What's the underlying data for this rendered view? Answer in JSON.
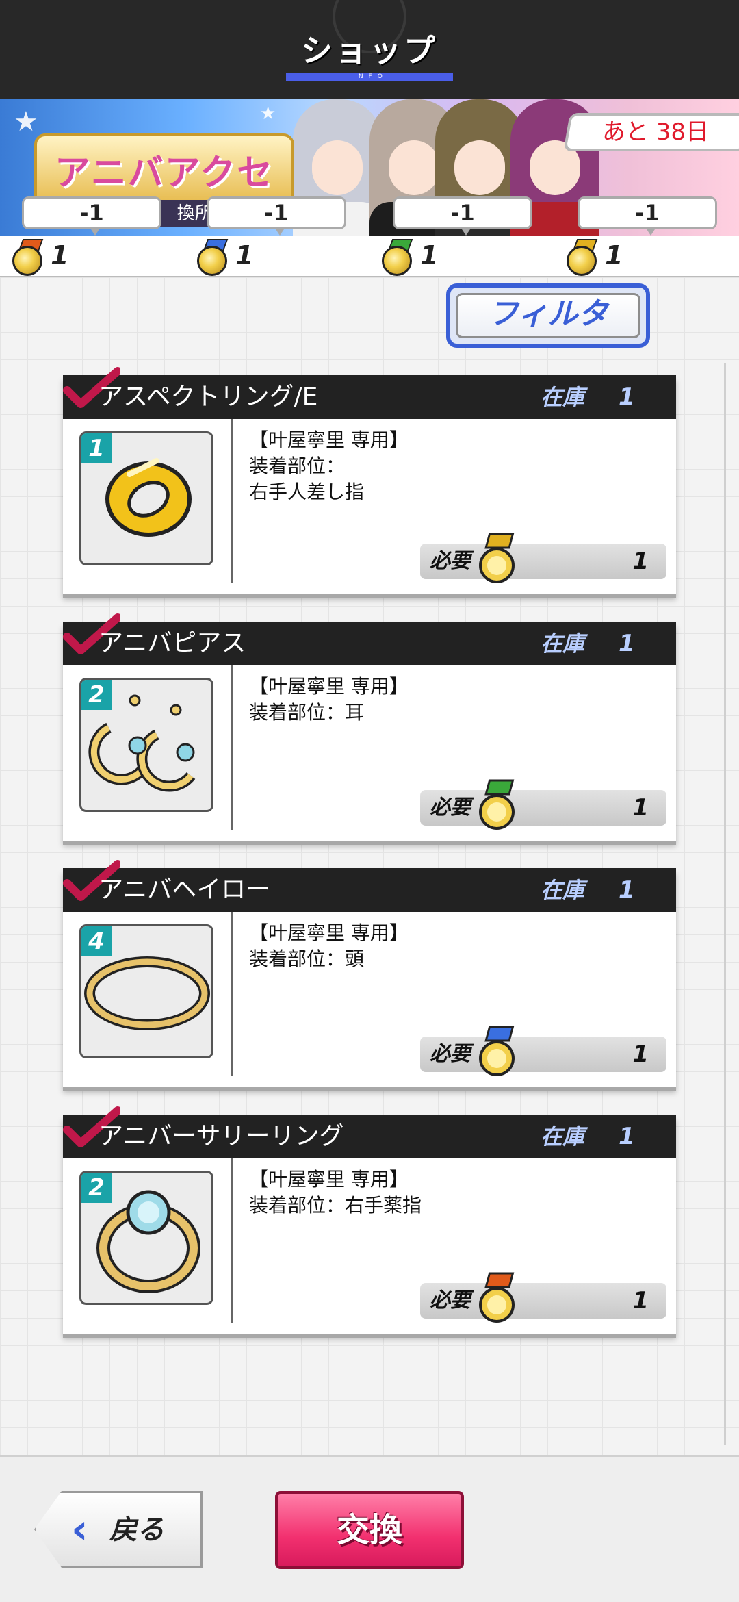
{
  "header": {
    "title": "ショップ",
    "subtitle": "INFO"
  },
  "banner": {
    "logo_text": "アニバアクセ",
    "logo_sub": "換所Pa",
    "days_left": "あと 38日"
  },
  "currencies": [
    {
      "bubble": "-1",
      "count": "1",
      "ribbon_color": "#e05a1a"
    },
    {
      "bubble": "-1",
      "count": "1",
      "ribbon_color": "#3a6fe0"
    },
    {
      "bubble": "-1",
      "count": "1",
      "ribbon_color": "#3aa83a"
    },
    {
      "bubble": "-1",
      "count": "1",
      "ribbon_color": "#e0b020"
    }
  ],
  "filter": {
    "label": "フィルタ"
  },
  "items": [
    {
      "name": "アスペクトリング/E",
      "stock_label": "在庫",
      "stock": "1",
      "rarity": "1",
      "owner": "【叶屋寧里 専用】",
      "slot_line1": "装着部位：",
      "slot_line2": "右手人差し指",
      "need_label": "必要",
      "need_count": "1",
      "need_ribbon": "#e0b020",
      "icon": "ring-icon"
    },
    {
      "name": "アニバピアス",
      "stock_label": "在庫",
      "stock": "1",
      "rarity": "2",
      "owner": "【叶屋寧里 専用】",
      "slot_line1": "装着部位：耳",
      "slot_line2": "",
      "need_label": "必要",
      "need_count": "1",
      "need_ribbon": "#3aa83a",
      "icon": "earrings-icon"
    },
    {
      "name": "アニバヘイロー",
      "stock_label": "在庫",
      "stock": "1",
      "rarity": "4",
      "owner": "【叶屋寧里 専用】",
      "slot_line1": "装着部位：頭",
      "slot_line2": "",
      "need_label": "必要",
      "need_count": "1",
      "need_ribbon": "#3a6fe0",
      "icon": "halo-icon"
    },
    {
      "name": "アニバーサリーリング",
      "stock_label": "在庫",
      "stock": "1",
      "rarity": "2",
      "owner": "【叶屋寧里 専用】",
      "slot_line1": "装着部位：右手薬指",
      "slot_line2": "",
      "need_label": "必要",
      "need_count": "1",
      "need_ribbon": "#e05a1a",
      "icon": "gem-ring-icon"
    }
  ],
  "footer": {
    "back_label": "戻る",
    "exchange_label": "交換"
  },
  "colors": {
    "accent": "#3a5fd6",
    "exchange": "#f2306f",
    "days_text": "#e01a2c",
    "rarity_badge": "#1aa3a8"
  }
}
